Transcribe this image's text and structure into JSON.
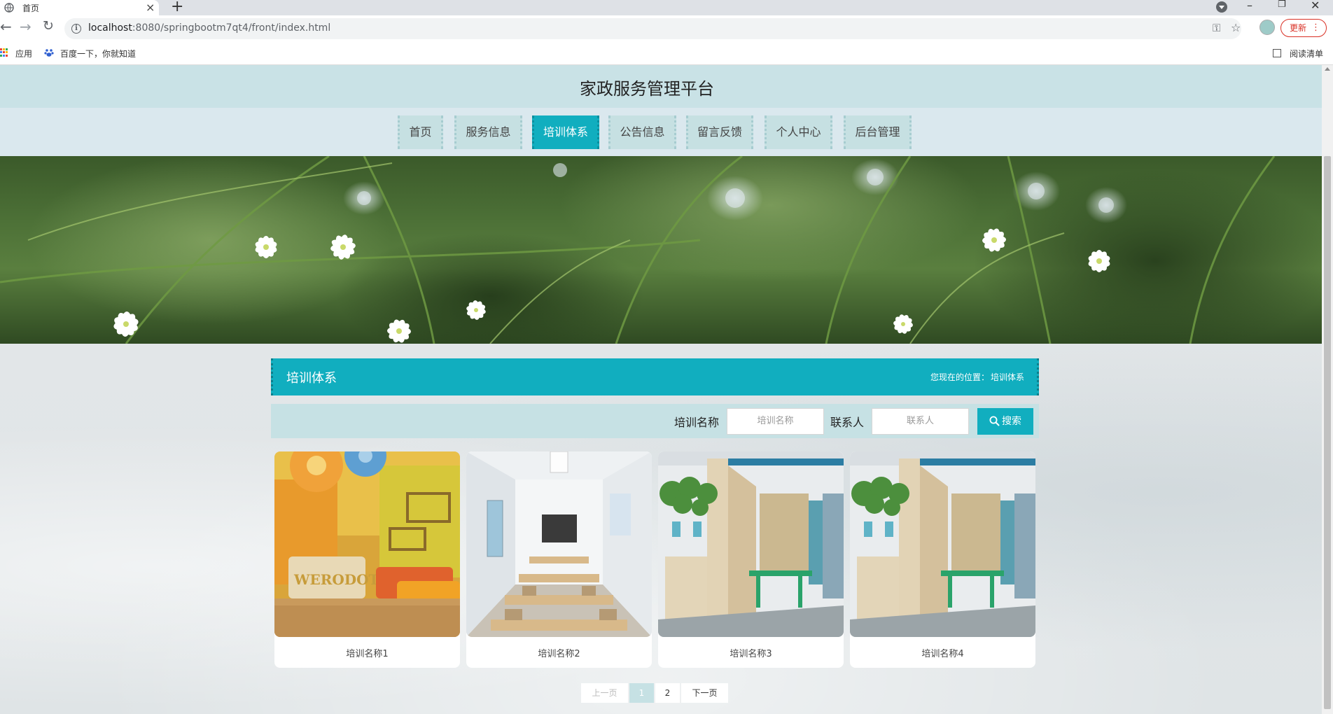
{
  "browser": {
    "tab_title": "首页",
    "url_host": "localhost",
    "url_path": ":8080/springbootm7qt4/front/index.html",
    "update_label": "更新",
    "bookmarks": [
      "应用",
      "百度一下，你就知道"
    ],
    "reading_list": "阅读清单"
  },
  "site": {
    "title": "家政服务管理平台",
    "nav": [
      "首页",
      "服务信息",
      "培训体系",
      "公告信息",
      "留言反馈",
      "个人中心",
      "后台管理"
    ],
    "active_nav": "培训体系"
  },
  "section": {
    "title": "培训体系",
    "breadcrumb_prefix": "您现在的位置：",
    "breadcrumb_current": "培训体系"
  },
  "search": {
    "name_label": "培训名称",
    "name_placeholder": "培训名称",
    "contact_label": "联系人",
    "contact_placeholder": "联系人",
    "button_label": "搜索"
  },
  "cards": [
    {
      "name": "培训名称1"
    },
    {
      "name": "培训名称2"
    },
    {
      "name": "培训名称3"
    },
    {
      "name": "培训名称4"
    }
  ],
  "pagination": {
    "prev": "上一页",
    "pages": [
      "1",
      "2"
    ],
    "current": "1",
    "next": "下一页"
  },
  "colors": {
    "accent": "#11aebf",
    "header_bg": "#c9e2e6",
    "nav_bg": "#dae8ee",
    "nav_item_bg": "#c6e0e2"
  }
}
